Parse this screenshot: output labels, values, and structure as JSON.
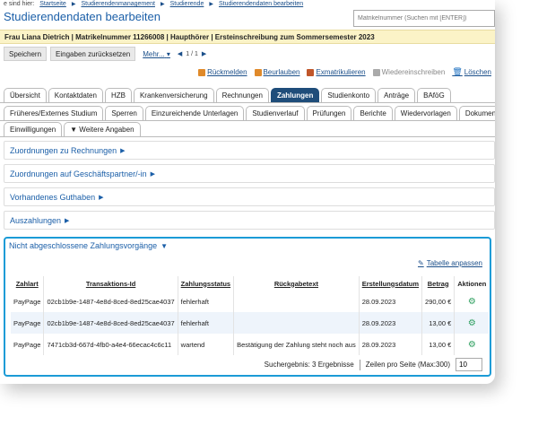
{
  "breadcrumb": {
    "prefix": "e sind hier:",
    "items": [
      "Startseite",
      "Studierendenmanagement",
      "Studierende",
      "Studierendendaten bearbeiten"
    ]
  },
  "page_title": "Studierendendaten bearbeiten",
  "search": {
    "placeholder": "Matrikelnummer (Suchen mit [ENTER])"
  },
  "student_info": "Frau Liana Dietrich | Matrikelnummer 11266008 | Haupthörer | Ersteinschreibung zum Sommersemester 2023",
  "toolbar": {
    "save": "Speichern",
    "reset": "Eingaben zurücksetzen",
    "more": "Mehr...",
    "pager": "1 / 1"
  },
  "actions": [
    "Rückmelden",
    "Beurlauben",
    "Exmatrikulieren",
    "Wiedereinschreiben",
    "Löschen"
  ],
  "tabs_row1": [
    "Übersicht",
    "Kontaktdaten",
    "HZB",
    "Krankenversicherung",
    "Rechnungen",
    "Zahlungen",
    "Studienkonto",
    "Anträge",
    "BAföG"
  ],
  "tabs_row2": [
    "Früheres/Externes Studium",
    "Sperren",
    "Einzureichende Unterlagen",
    "Studienverlauf",
    "Prüfungen",
    "Berichte",
    "Wiedervorlagen",
    "Dokumente"
  ],
  "tabs_row3": [
    "Einwilligungen",
    "▼ Weitere Angaben"
  ],
  "active_tab": "Zahlungen",
  "sections": [
    "Zuordnungen zu Rechnungen",
    "Zuordnungen auf Geschäftspartner/-in",
    "Vorhandenes Guthaben",
    "Auszahlungen"
  ],
  "open_section": {
    "title": "Nicht abgeschlossene Zahlungsvorgänge",
    "adjust_table": "Tabelle anpassen",
    "columns": [
      "Zahlart",
      "Transaktions-Id",
      "Zahlungsstatus",
      "Rückgabetext",
      "Erstellungsdatum",
      "Betrag",
      "Aktionen"
    ],
    "rows": [
      [
        "PayPage",
        "02cb1b9e-1487-4e8d-8ced-8ed25cae4037",
        "fehlerhaft",
        "",
        "28.09.2023",
        "290,00 €"
      ],
      [
        "PayPage",
        "02cb1b9e-1487-4e8d-8ced-8ed25cae4037",
        "fehlerhaft",
        "",
        "28.09.2023",
        "13,00 €"
      ],
      [
        "PayPage",
        "7471cb3d-667d-4fb0-a4e4-66ecac4c6c11",
        "wartend",
        "Bestätigung der Zahlung steht noch aus",
        "28.09.2023",
        "13,00 €"
      ]
    ],
    "result_text": "Suchergebnis: 3 Ergebnisse",
    "per_page_label": "Zeilen pro Seite (Max:300)",
    "per_page_value": "10"
  }
}
